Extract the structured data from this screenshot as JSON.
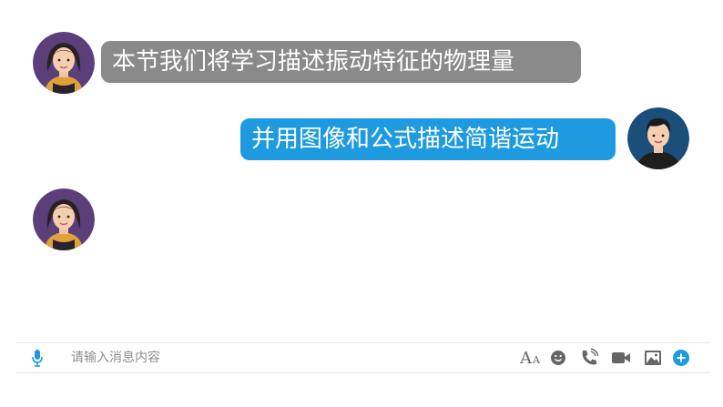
{
  "colors": {
    "incoming_bubble": "#8a8a8a",
    "outgoing_bubble": "#1e9be0",
    "icon_gray": "#666666",
    "accent_blue": "#1e9be0"
  },
  "messages": [
    {
      "sender": "female-teacher",
      "side": "left",
      "text": "本节我们将学习描述振动特征的物理量"
    },
    {
      "sender": "male-student",
      "side": "right",
      "text": "并用图像和公式描述简谐运动"
    }
  ],
  "composer": {
    "placeholder": "请输入消息内容",
    "value": "",
    "font_size_button_label_big": "A",
    "font_size_button_label_small": "A",
    "icons": [
      "microphone-icon",
      "font-size-icon",
      "emoji-icon",
      "phone-call-icon",
      "video-call-icon",
      "image-icon",
      "add-icon"
    ]
  }
}
